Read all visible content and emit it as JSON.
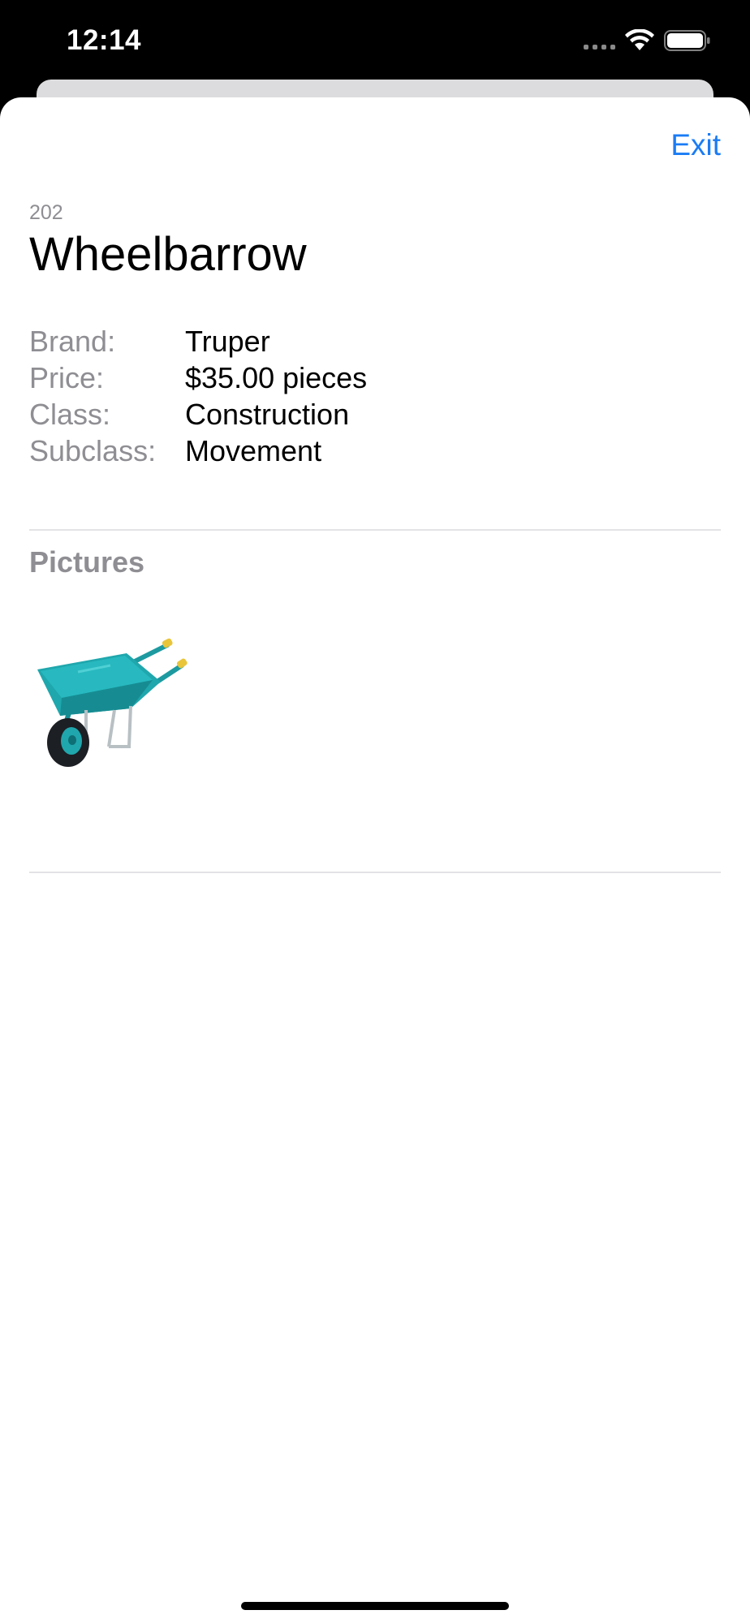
{
  "status_bar": {
    "time": "12:14"
  },
  "header": {
    "exit_label": "Exit"
  },
  "item": {
    "number": "202",
    "title": "Wheelbarrow"
  },
  "details": [
    {
      "label": "Brand:",
      "value": "Truper"
    },
    {
      "label": "Price:",
      "value": "$35.00 pieces"
    },
    {
      "label": "Class:",
      "value": "Construction"
    },
    {
      "label": "Subclass:",
      "value": "Movement"
    }
  ],
  "pictures": {
    "section_title": "Pictures",
    "images": [
      {
        "icon": "wheelbarrow-image"
      }
    ]
  },
  "colors": {
    "accent": "#1a7cf5",
    "secondary_text": "#8e8e93",
    "wheelbarrow": "#1fa7ad"
  }
}
